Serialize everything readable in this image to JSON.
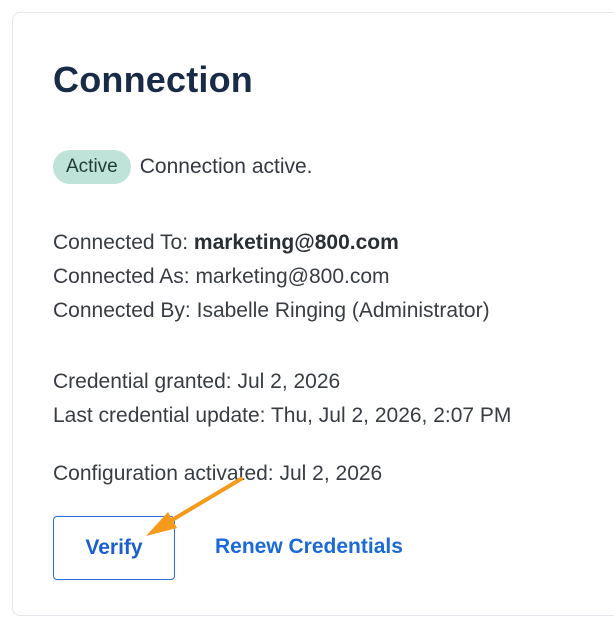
{
  "card": {
    "title": "Connection",
    "status": {
      "badge": "Active",
      "text": "Connection active."
    },
    "connection": {
      "to_label": "Connected To:",
      "to_value": "marketing@800.com",
      "as_label": "Connected As:",
      "as_value": "marketing@800.com",
      "by_label": "Connected By:",
      "by_value": "Isabelle Ringing (Administrator)"
    },
    "credentials": {
      "granted_label": "Credential granted:",
      "granted_value": "Jul 2, 2026",
      "updated_label": "Last credential update:",
      "updated_value": "Thu, Jul 2, 2026, 2:07 PM"
    },
    "configuration": {
      "activated_label": "Configuration activated:",
      "activated_value": "Jul 2, 2026"
    },
    "actions": {
      "verify_label": "Verify",
      "renew_label": "Renew Credentials"
    }
  },
  "colors": {
    "title": "#1a2b48",
    "badge_bg": "#bfe3d9",
    "link": "#1a6ad8",
    "button_border": "#2c6fd6",
    "annotation_arrow": "#f59a1b"
  },
  "annotation": {
    "icon": "arrow-pointer-icon"
  }
}
